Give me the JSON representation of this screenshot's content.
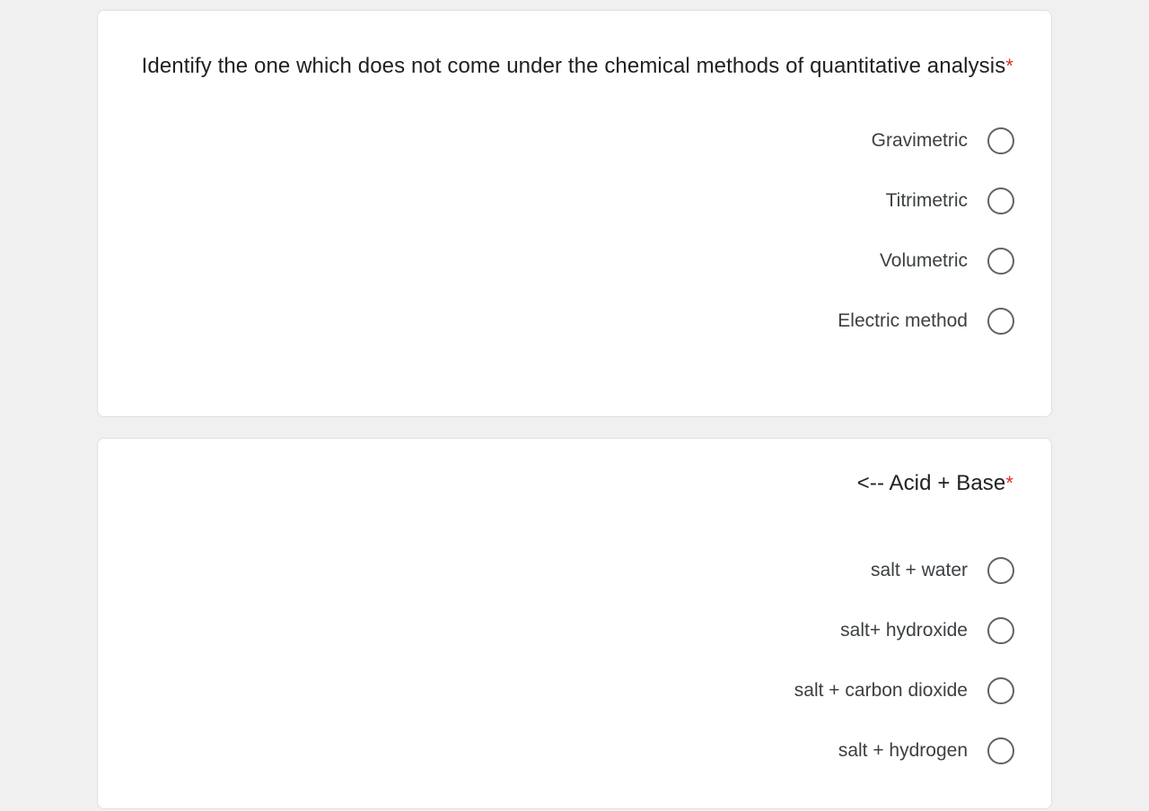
{
  "theme": {
    "page_background": "#f0f0f0",
    "card_background": "#ffffff",
    "card_border": "#e0e0e0",
    "question_text_color": "#202124",
    "option_text_color": "#3c4043",
    "radio_border_color": "#5f6368",
    "required_asterisk_color": "#d93025"
  },
  "form": {
    "required_marker": "*",
    "questions": [
      {
        "title": "Identify the one which does not come under the chemical methods of quantitative analysis",
        "required": true,
        "input_type": "radio",
        "selected": null,
        "options": [
          {
            "label": "Gravimetric",
            "selected": false
          },
          {
            "label": "Titrimetric",
            "selected": false
          },
          {
            "label": "Volumetric",
            "selected": false
          },
          {
            "label": "Electric method",
            "selected": false
          }
        ]
      },
      {
        "title": "<-- Acid + Base",
        "required": true,
        "input_type": "radio",
        "selected": null,
        "options": [
          {
            "label": "salt + water",
            "selected": false
          },
          {
            "label": "salt+ hydroxide",
            "selected": false
          },
          {
            "label": "salt + carbon dioxide",
            "selected": false
          },
          {
            "label": "salt + hydrogen",
            "selected": false
          }
        ]
      }
    ]
  }
}
